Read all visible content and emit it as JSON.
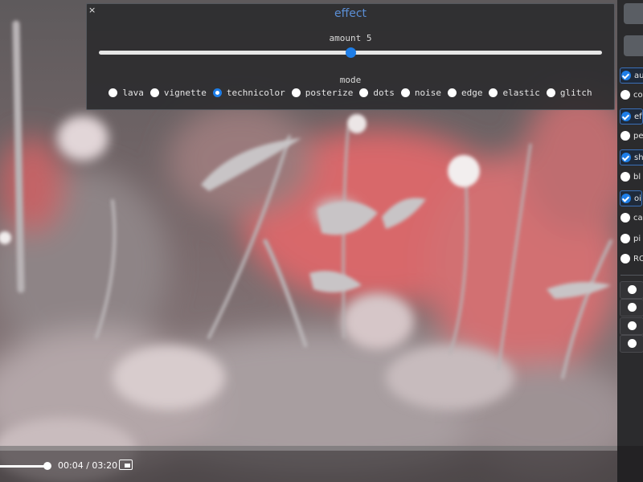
{
  "effect_panel": {
    "close_label": "×",
    "title": "effect",
    "amount_label": "amount 5",
    "amount_value": 5,
    "amount_fraction": 0.5,
    "mode_label": "mode",
    "modes": [
      {
        "label": "lava",
        "selected": false
      },
      {
        "label": "vignette",
        "selected": false
      },
      {
        "label": "technicolor",
        "selected": true
      },
      {
        "label": "posterize",
        "selected": false
      },
      {
        "label": "dots",
        "selected": false
      },
      {
        "label": "noise",
        "selected": false
      },
      {
        "label": "edge",
        "selected": false
      },
      {
        "label": "elastic",
        "selected": false
      },
      {
        "label": "glitch",
        "selected": false
      }
    ]
  },
  "side_panel": {
    "items": [
      {
        "label": "au",
        "checked": true
      },
      {
        "label": "co",
        "checked": false
      },
      {
        "label": "ef",
        "checked": true
      },
      {
        "label": "pe",
        "checked": false
      },
      {
        "label": "sh",
        "checked": true
      },
      {
        "label": "bl",
        "checked": false
      },
      {
        "label": "oi",
        "checked": true
      },
      {
        "label": "ca",
        "checked": false
      },
      {
        "label": "pi",
        "checked": false
      },
      {
        "label": "RO",
        "checked": false
      }
    ]
  },
  "player": {
    "time": "00:04 / 03:20",
    "volume_fraction": 1.0
  },
  "colors": {
    "accent": "#1e7ee8",
    "title": "#5b8fd6",
    "panel_bg": "#2c2c2f"
  }
}
